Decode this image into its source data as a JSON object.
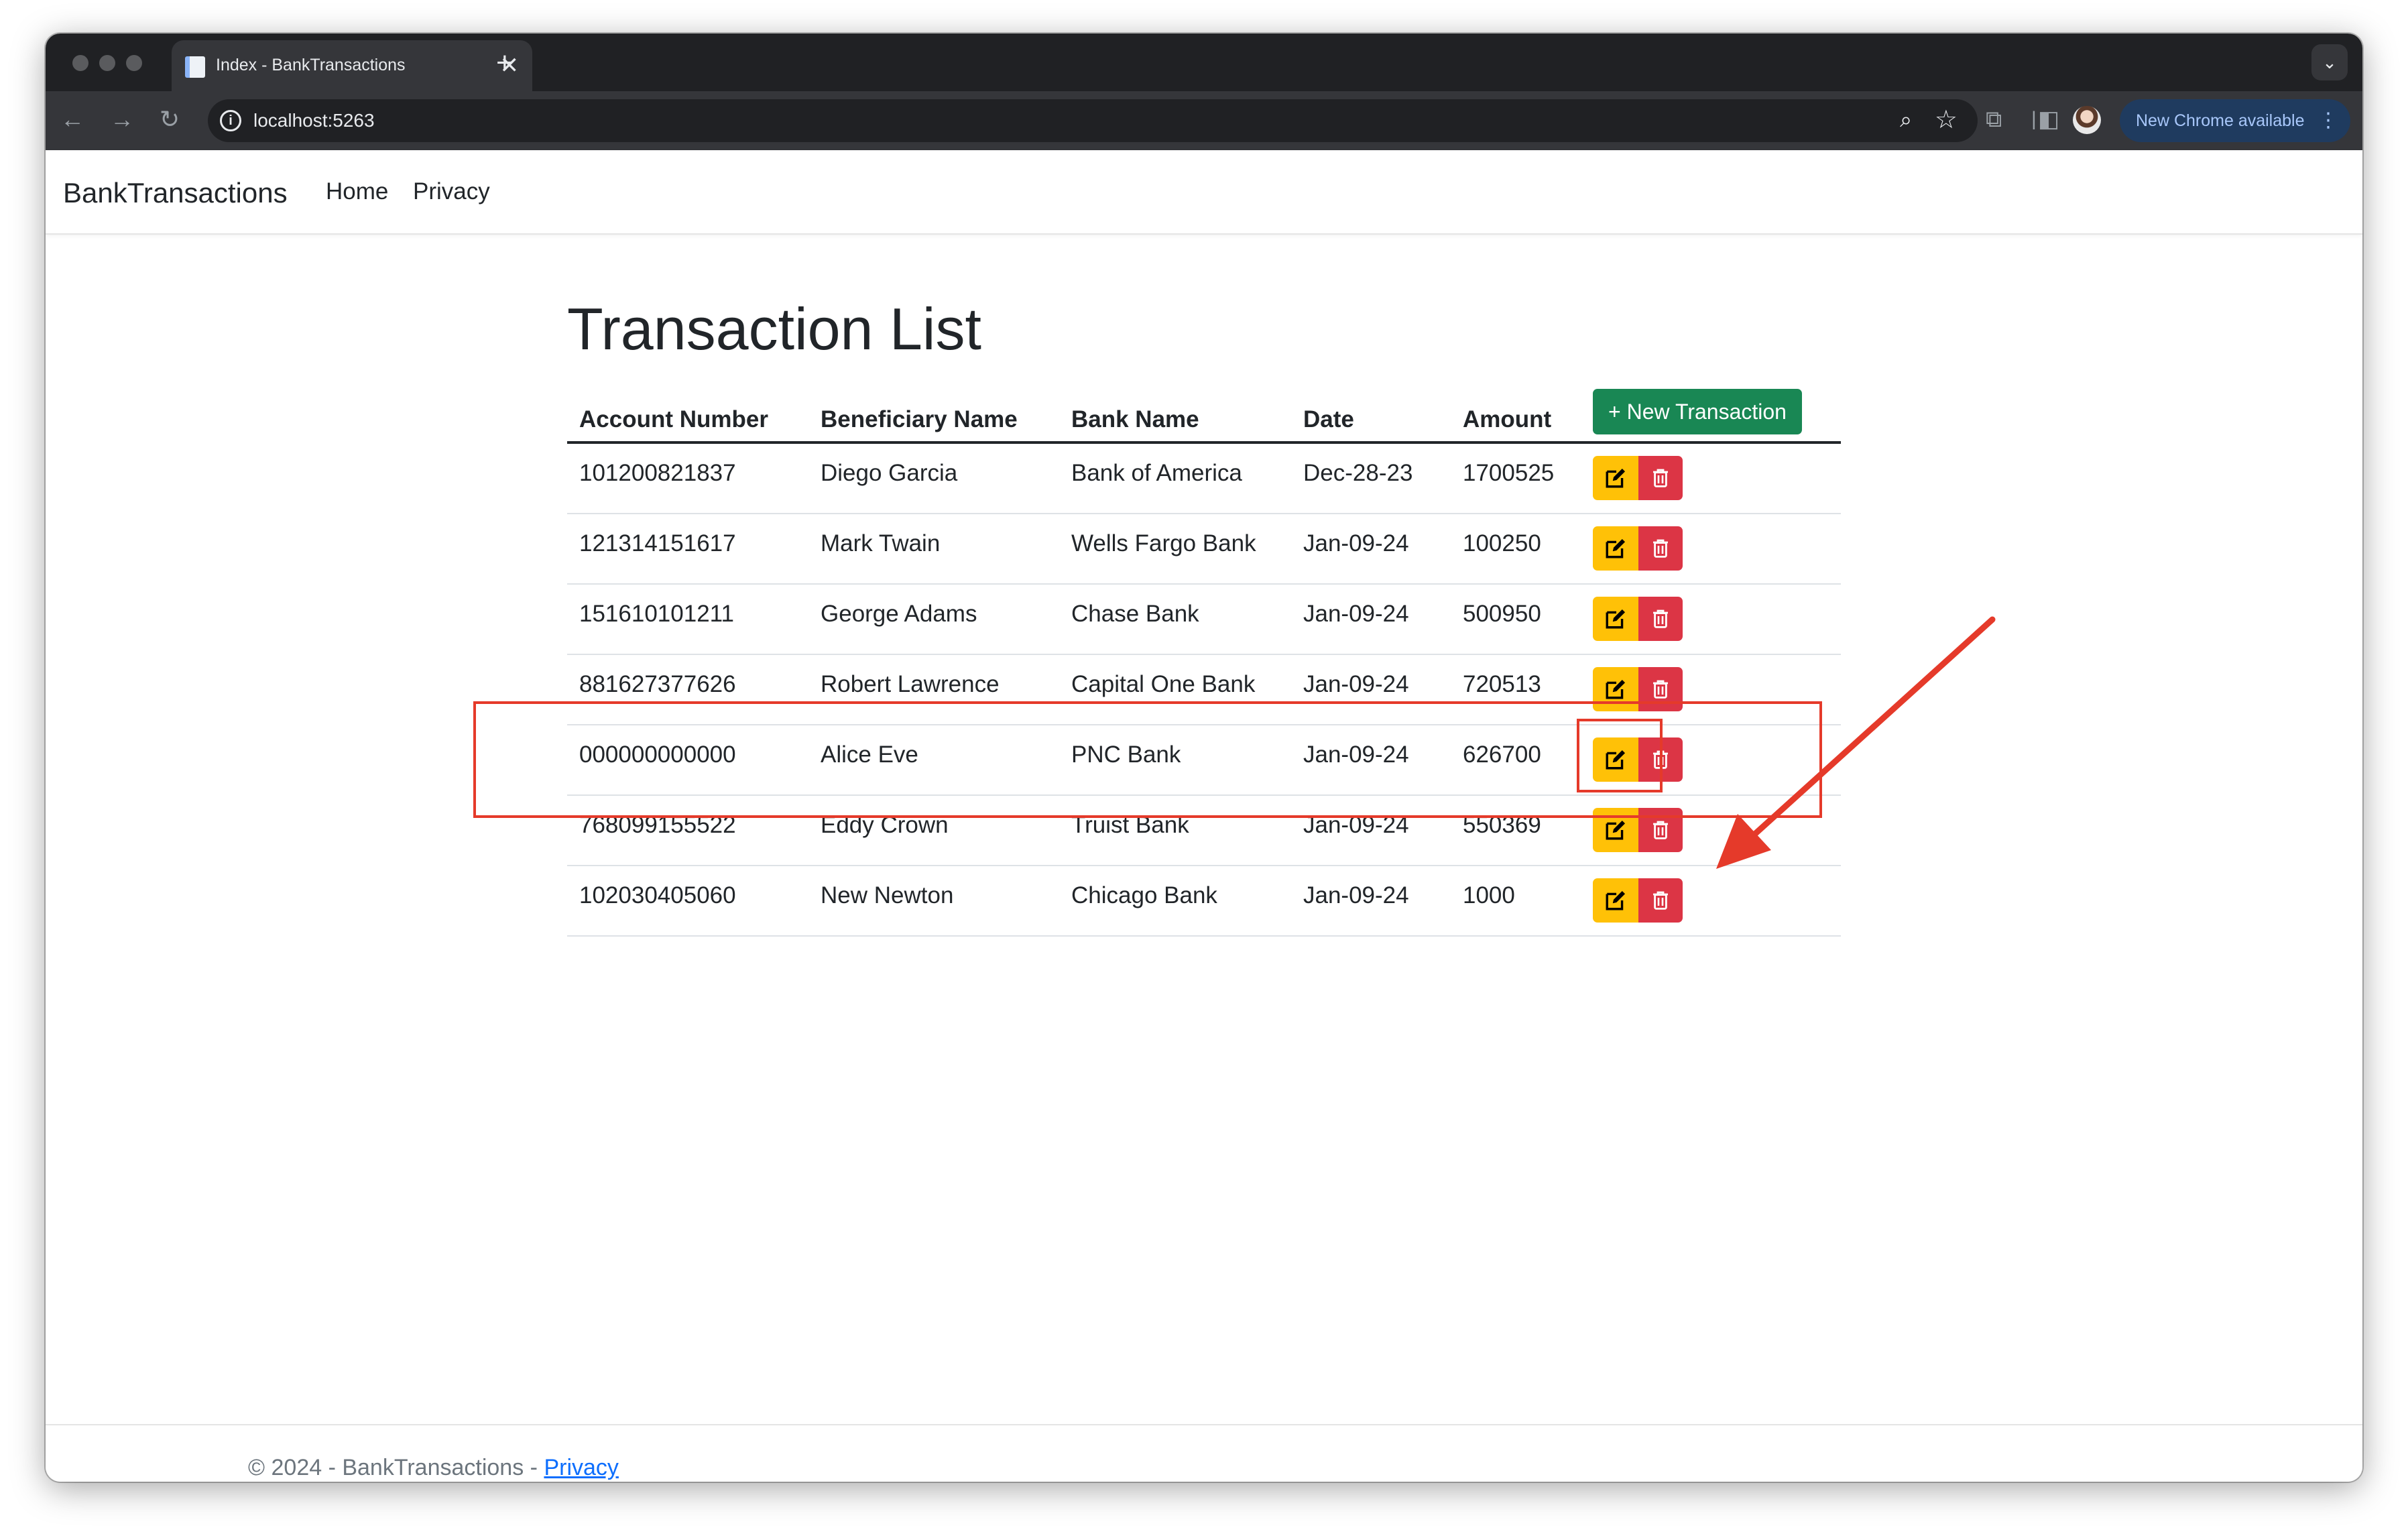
{
  "browser": {
    "tab_title": "Index - BankTransactions",
    "tab_close": "✕",
    "new_tab": "+",
    "url": "localhost:5263",
    "update_label": "New Chrome available"
  },
  "nav": {
    "brand": "BankTransactions",
    "links": [
      "Home",
      "Privacy"
    ]
  },
  "main": {
    "title": "Transaction List",
    "new_button": "+ New Transaction",
    "columns": [
      "Account Number",
      "Beneficiary Name",
      "Bank Name",
      "Date",
      "Amount"
    ],
    "rows": [
      [
        "101200821837",
        "Diego Garcia",
        "Bank of America",
        "Dec-28-23",
        "1700525"
      ],
      [
        "121314151617",
        "Mark Twain",
        "Wells Fargo Bank",
        "Jan-09-24",
        "100250"
      ],
      [
        "151610101211",
        "George Adams",
        "Chase Bank",
        "Jan-09-24",
        "500950"
      ],
      [
        "881627377626",
        "Robert Lawrence",
        "Capital One Bank",
        "Jan-09-24",
        "720513"
      ],
      [
        "000000000000",
        "Alice Eve",
        "PNC Bank",
        "Jan-09-24",
        "626700"
      ],
      [
        "768099155522",
        "Eddy Crown",
        "Truist Bank",
        "Jan-09-24",
        "550369"
      ],
      [
        "102030405060",
        "New Newton",
        "Chicago Bank",
        "Jan-09-24",
        "1000"
      ]
    ]
  },
  "footer": {
    "text": "© 2024 - BankTransactions - ",
    "link": "Privacy"
  },
  "colors": {
    "primary_success": "#198754",
    "edit_button": "#ffc107",
    "delete_button": "#dc3545",
    "annotation": "#e53a2a"
  }
}
